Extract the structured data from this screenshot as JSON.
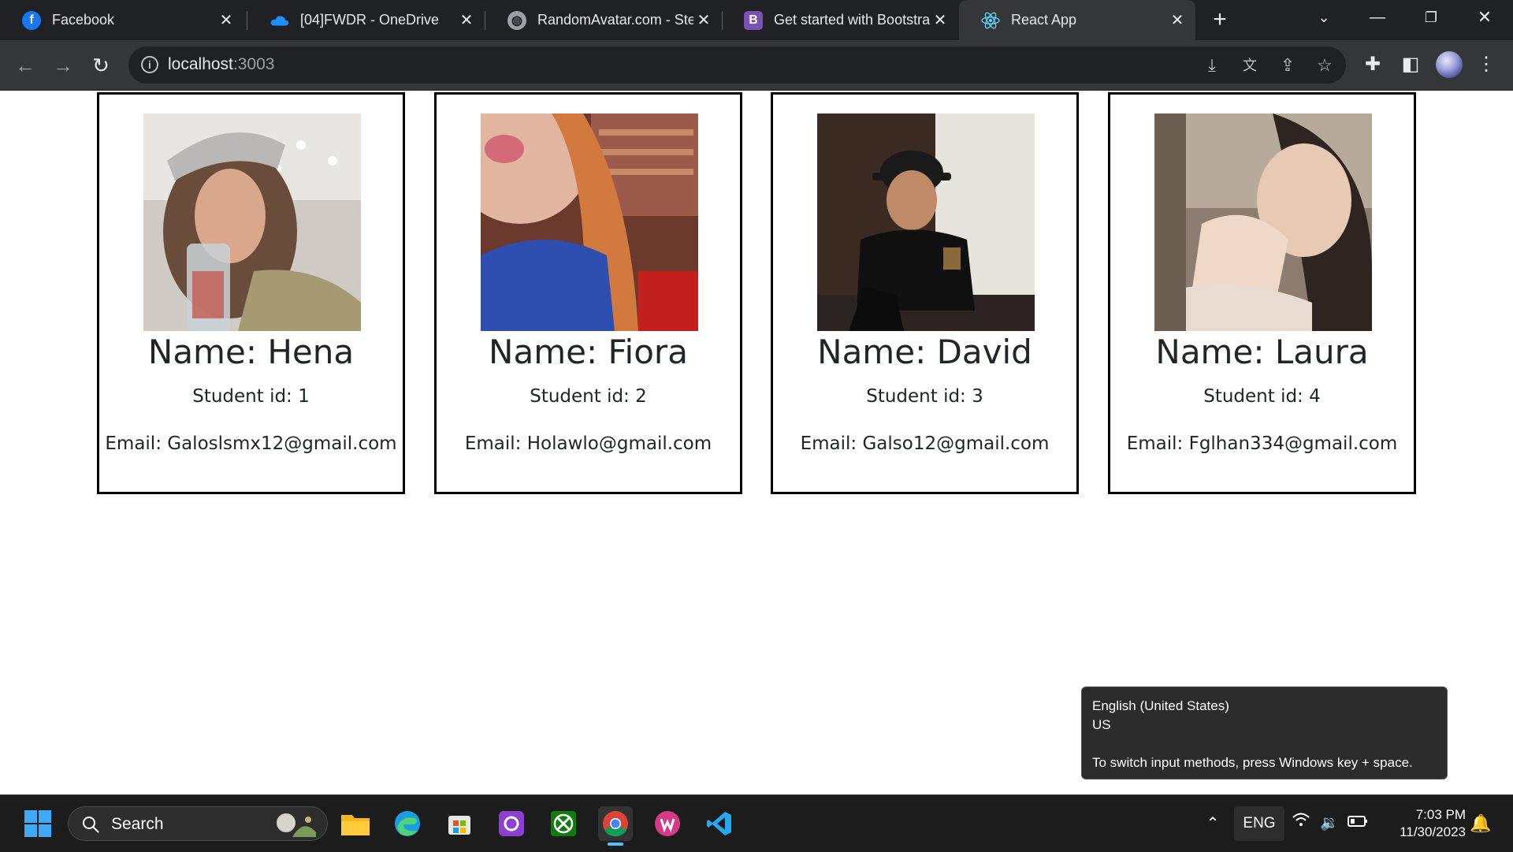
{
  "browser": {
    "tabs": [
      {
        "title": "Facebook",
        "icon": "facebook-icon",
        "color": "#1877f2"
      },
      {
        "title": "[04]FWDR - OneDrive",
        "icon": "onedrive-icon",
        "color": "#0f6cbd"
      },
      {
        "title": "RandomAvatar.com - Ste",
        "icon": "globe-icon",
        "color": "#9aa0a6"
      },
      {
        "title": "Get started with Bootstra",
        "icon": "bootstrap-icon",
        "color": "#7952b3"
      },
      {
        "title": "React App",
        "icon": "react-icon",
        "color": "#61dafb"
      }
    ],
    "url_host": "localhost",
    "url_port": ":3003"
  },
  "students": [
    {
      "name": "Name: Hena",
      "id": "Student id: 1",
      "email": "Email: Galoslsmx12@gmail.com"
    },
    {
      "name": "Name: Fiora",
      "id": "Student id: 2",
      "email": "Email: Holawlo@gmail.com"
    },
    {
      "name": "Name: David",
      "id": "Student id: 3",
      "email": "Email: Galso12@gmail.com"
    },
    {
      "name": "Name: Laura",
      "id": "Student id: 4",
      "email": "Email: Fglhan334@gmail.com"
    }
  ],
  "tooltip": {
    "line1": "English (United States)",
    "line2": "US",
    "line3": "To switch input methods, press Windows key + space."
  },
  "taskbar": {
    "search_label": "Search",
    "language": "ENG",
    "time": "7:03 PM",
    "date": "11/30/2023"
  }
}
